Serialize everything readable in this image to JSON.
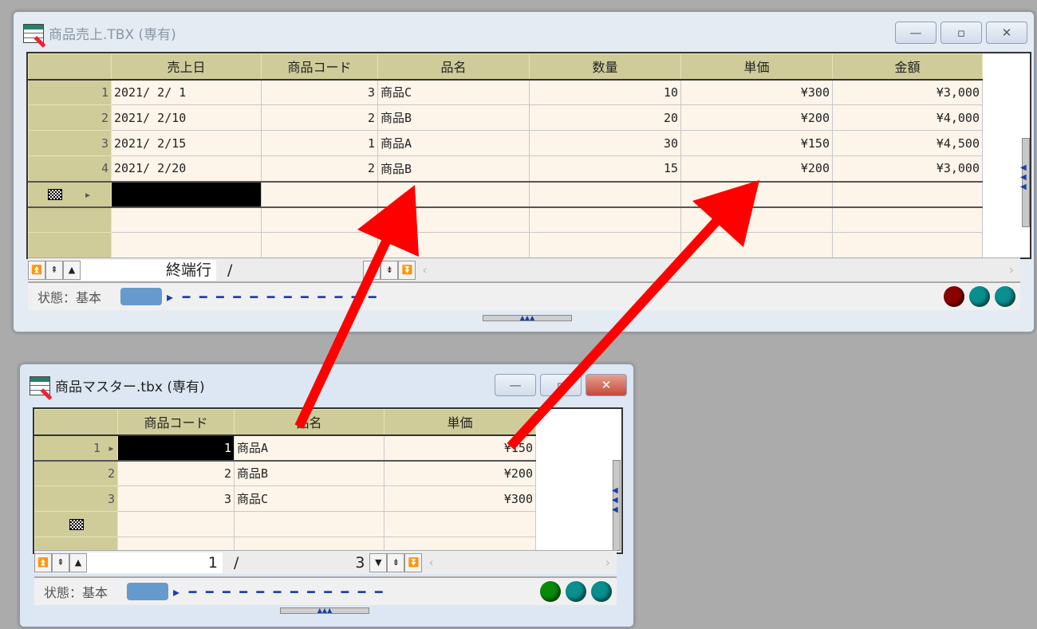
{
  "sales_window": {
    "title": "商品売上.TBX (専有)",
    "columns": [
      "",
      "売上日",
      "商品コード",
      "品名",
      "数量",
      "単価",
      "金額"
    ],
    "rows": [
      [
        "1",
        "2021/ 2/ 1",
        "3",
        "商品C",
        "10",
        "¥300",
        "¥3,000"
      ],
      [
        "2",
        "2021/ 2/10",
        "2",
        "商品B",
        "20",
        "¥200",
        "¥4,000"
      ],
      [
        "3",
        "2021/ 2/15",
        "1",
        "商品A",
        "30",
        "¥150",
        "¥4,500"
      ],
      [
        "4",
        "2021/ 2/20",
        "2",
        "商品B",
        "15",
        "¥200",
        "¥3,000"
      ]
    ],
    "nav_current": "終端行",
    "nav_separator": "/",
    "nav_total": "",
    "status_label": "状態：基本",
    "leds": [
      "#8b0000",
      "#0a8f8f",
      "#0a8f8f"
    ]
  },
  "master_window": {
    "title": "商品マスター.tbx (専有)",
    "columns": [
      "",
      "商品コード",
      "品名",
      "単価"
    ],
    "rows": [
      [
        "1",
        "1",
        "商品A",
        "¥150"
      ],
      [
        "2",
        "2",
        "商品B",
        "¥200"
      ],
      [
        "3",
        "3",
        "商品C",
        "¥300"
      ]
    ],
    "nav_current": "1",
    "nav_separator": "/",
    "nav_total": "3",
    "status_label": "状態：基本",
    "leds": [
      "#0a8a0a",
      "#0a8f8f",
      "#0a8f8f"
    ]
  },
  "window_buttons": {
    "minimize": "—",
    "maximize": "▫",
    "close": "✕"
  },
  "annotation_arrow_color": "#ff0000"
}
